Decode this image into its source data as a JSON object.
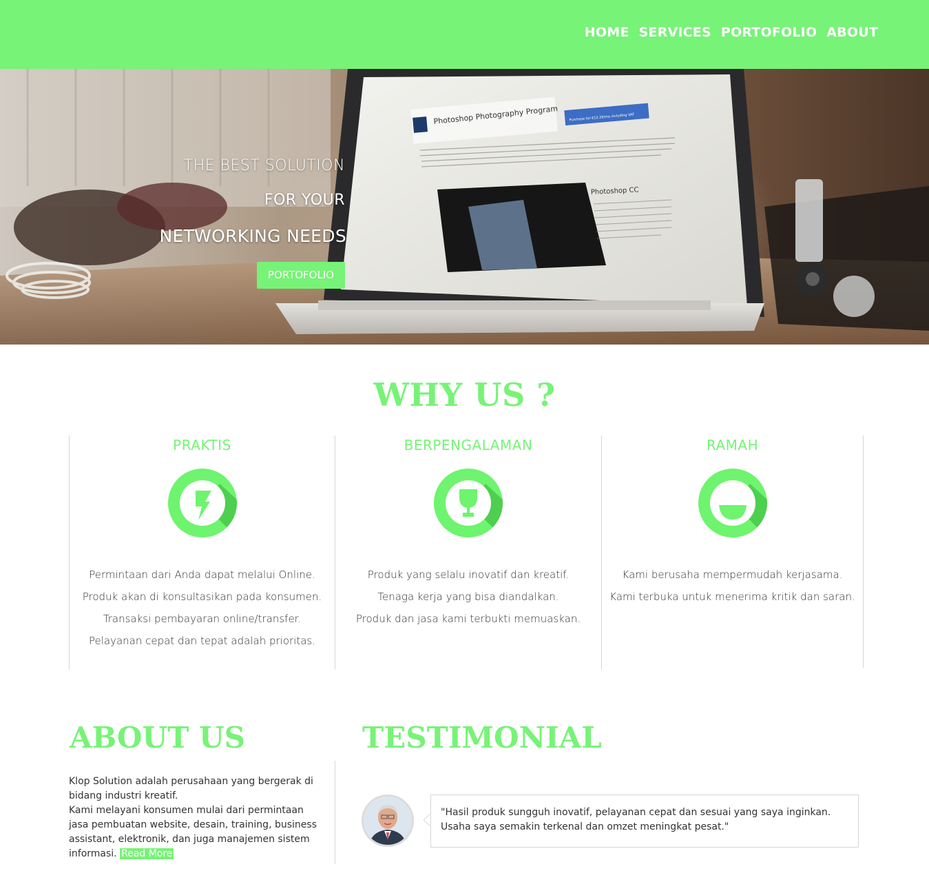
{
  "colors": {
    "accent": "#77f377",
    "icon_circle": "#6ef46e",
    "icon_shadow": "#4fcf4f",
    "text": "#333333"
  },
  "nav": {
    "items": [
      "HOME",
      "SERVICES",
      "PORTOFOLIO",
      "ABOUT"
    ]
  },
  "hero": {
    "line1": "THE BEST SOLUTION",
    "line2": "FOR YOUR",
    "line3": "NETWORKING NEEDS",
    "button": "PORTOFOLIO",
    "screen_title": "Photoshop Photography Program",
    "screen_button": "Purchase for €12.29/mo including VAT",
    "screen_subtitle": "Photoshop CC"
  },
  "why": {
    "title": "WHY US ?",
    "features": [
      {
        "title": "PRAKTIS",
        "icon": "lightning-icon",
        "lines": [
          "Permintaan dari Anda dapat melalui Online.",
          "Produk akan di konsultasikan pada konsumen.",
          "Transaksi pembayaran online/transfer.",
          "Pelayanan cepat dan tepat adalah prioritas."
        ]
      },
      {
        "title": "BERPENGALAMAN",
        "icon": "trophy-icon",
        "lines": [
          "Produk yang selalu inovatif dan kreatif.",
          "Tenaga kerja yang bisa diandalkan.",
          "Produk dan jasa kami terbukti memuaskan."
        ]
      },
      {
        "title": "RAMAH",
        "icon": "smile-icon",
        "lines": [
          "Kami berusaha mempermudah kerjasama.",
          "Kami terbuka untuk menerima kritik dan saran."
        ]
      }
    ]
  },
  "about": {
    "title": "ABOUT US",
    "text1": "Klop Solution adalah perusahaan yang bergerak di bidang industri kreatif.",
    "text2": "Kami melayani konsumen mulai dari permintaan jasa pembuatan website, desain, training, business assistant, elektronik, dan juga manajemen sistem informasi.",
    "read_more": "Read More"
  },
  "testimonial": {
    "title": "TESTIMONIAL",
    "quote": "\"Hasil produk sungguh inovatif, pelayanan cepat dan sesuai yang saya inginkan. Usaha saya semakin terkenal dan omzet meningkat pesat.\""
  }
}
